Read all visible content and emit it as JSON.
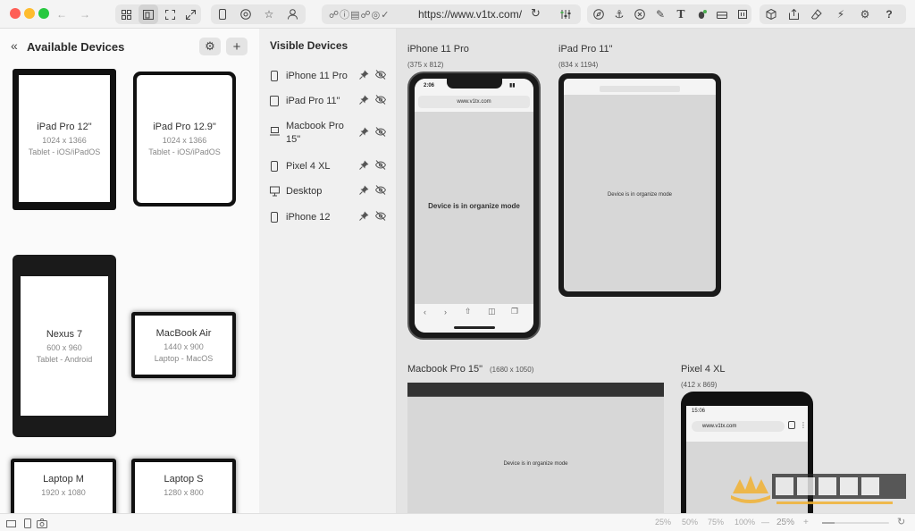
{
  "toolbar": {
    "url": "https://www.v1tx.com/",
    "traffic_colors": [
      "#fe5f57",
      "#febc2e",
      "#28c840"
    ]
  },
  "left_panel": {
    "title": "Available Devices",
    "devices": [
      {
        "name": "iPad Pro 12\"",
        "res": "1024 x 1366",
        "type": "Tablet - iOS/iPadOS"
      },
      {
        "name": "iPad Pro 12.9\"",
        "res": "1024 x 1366",
        "type": "Tablet - iOS/iPadOS"
      },
      {
        "name": "Nexus 7",
        "res": "600 x 960",
        "type": "Tablet - Android"
      },
      {
        "name": "MacBook Air",
        "res": "1440 x 900",
        "type": "Laptop - MacOS"
      },
      {
        "name": "Laptop M",
        "res": "1920 x 1080",
        "type": ""
      },
      {
        "name": "Laptop S",
        "res": "1280 x 800",
        "type": ""
      }
    ]
  },
  "visible_panel": {
    "title": "Visible Devices",
    "items": [
      {
        "label": "iPhone 11 Pro",
        "icon": "phone-icon"
      },
      {
        "label": "iPad Pro 11\"",
        "icon": "tablet-icon"
      },
      {
        "label": "Macbook Pro 15\"",
        "icon": "laptop-icon"
      },
      {
        "label": "Pixel 4 XL",
        "icon": "phone-icon"
      },
      {
        "label": "Desktop",
        "icon": "monitor-icon"
      },
      {
        "label": "iPhone 12",
        "icon": "phone-icon"
      }
    ]
  },
  "canvas": {
    "iphone": {
      "name": "iPhone 11 Pro",
      "res": "(375 x 812)",
      "time": "2:06",
      "url": "www.v1tx.com",
      "mode": "Device is in organize mode"
    },
    "ipad": {
      "name": "iPad Pro 11\"",
      "res": "(834 x 1194)",
      "mode": "Device is in organize mode"
    },
    "macbook": {
      "name": "Macbook Pro 15\"",
      "res": "(1680 x 1050)",
      "mode": "Device is in organize mode"
    },
    "pixel": {
      "name": "Pixel 4 XL",
      "res": "(412 x 869)",
      "time": "15:06",
      "url": "www.v1tx.com"
    }
  },
  "status": {
    "zoom_levels": [
      "25%",
      "50%",
      "75%",
      "100%"
    ],
    "current_zoom": "25%",
    "minus": "—",
    "plus": "+"
  }
}
